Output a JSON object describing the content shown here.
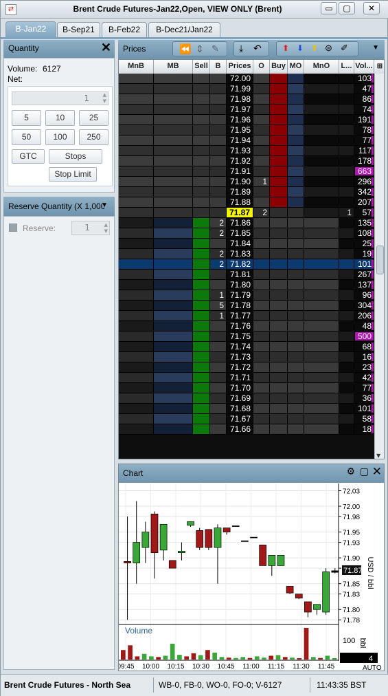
{
  "window": {
    "title": "Brent Crude Futures-Jan22,Open, VIEW ONLY (Brent)",
    "min_glyph": "▭",
    "max_glyph": "▢",
    "close_glyph": "✕"
  },
  "tabs": [
    "B-Jan22",
    "B-Sep21",
    "B-Feb22",
    "B-Dec21/Jan22"
  ],
  "quantity": {
    "title": "Quantity",
    "volume_label": "Volume:",
    "volume_value": "6127",
    "net_label": "Net:",
    "qty_value": "1",
    "presets": [
      "5",
      "10",
      "25",
      "50",
      "100",
      "250"
    ],
    "gtc": "GTC",
    "stops": "Stops",
    "stop_limit": "Stop Limit"
  },
  "reserve": {
    "title": "Reserve Quantity (X 1,000)",
    "label": "Reserve:",
    "value": "1"
  },
  "prices_panel": {
    "title": "Prices",
    "columns": [
      "MnB",
      "MB",
      "Sell",
      "B",
      "Prices",
      "O",
      "Buy",
      "MO",
      "MnO",
      "L...",
      "Vol..."
    ],
    "ltp": "71.87",
    "rows": [
      {
        "price": "72.00",
        "o": "",
        "l": "",
        "vol": "103",
        "mark": "ask"
      },
      {
        "price": "71.99",
        "o": "",
        "l": "",
        "vol": "47",
        "mark": "ask"
      },
      {
        "price": "71.98",
        "o": "",
        "l": "",
        "vol": "86",
        "mark": "ask"
      },
      {
        "price": "71.97",
        "o": "",
        "l": "",
        "vol": "74",
        "mark": "ask"
      },
      {
        "price": "71.96",
        "o": "",
        "l": "",
        "vol": "191",
        "mark": "ask"
      },
      {
        "price": "71.95",
        "o": "",
        "l": "",
        "vol": "78",
        "mark": "ask"
      },
      {
        "price": "71.94",
        "o": "",
        "l": "",
        "vol": "77",
        "mark": "ask"
      },
      {
        "price": "71.93",
        "o": "",
        "l": "",
        "vol": "117",
        "mark": "ask"
      },
      {
        "price": "71.92",
        "o": "",
        "l": "",
        "vol": "178",
        "mark": "ask"
      },
      {
        "price": "71.91",
        "o": "",
        "l": "",
        "vol": "663",
        "mark": "ask"
      },
      {
        "price": "71.90",
        "o": "1",
        "l": "",
        "vol": "296",
        "mark": "ask"
      },
      {
        "price": "71.89",
        "o": "",
        "l": "",
        "vol": "342",
        "mark": "ask"
      },
      {
        "price": "71.88",
        "o": "",
        "l": "",
        "vol": "207",
        "mark": "ask"
      },
      {
        "price": "71.87",
        "o": "2",
        "l": "1",
        "vol": "57",
        "mark": "ltp"
      },
      {
        "price": "71.86",
        "b": "2",
        "vol": "135",
        "mark": "bid"
      },
      {
        "price": "71.85",
        "b": "2",
        "vol": "108",
        "mark": "bid"
      },
      {
        "price": "71.84",
        "b": "",
        "vol": "25",
        "mark": "bid"
      },
      {
        "price": "71.83",
        "b": "2",
        "vol": "19",
        "mark": "bid"
      },
      {
        "price": "71.82",
        "b": "2",
        "vol": "101",
        "mark": "sel"
      },
      {
        "price": "71.81",
        "b": "",
        "vol": "267",
        "mark": "bid"
      },
      {
        "price": "71.80",
        "b": "",
        "vol": "137",
        "mark": "bid"
      },
      {
        "price": "71.79",
        "b": "1",
        "vol": "96",
        "mark": "bid"
      },
      {
        "price": "71.78",
        "b": "5",
        "vol": "304",
        "mark": "bid"
      },
      {
        "price": "71.77",
        "b": "1",
        "vol": "206",
        "mark": "bid"
      },
      {
        "price": "71.76",
        "b": "",
        "vol": "48",
        "mark": "bid"
      },
      {
        "price": "71.75",
        "b": "",
        "vol": "500",
        "mark": "bid"
      },
      {
        "price": "71.74",
        "b": "",
        "vol": "68",
        "mark": "bid"
      },
      {
        "price": "71.73",
        "b": "",
        "vol": "16",
        "mark": "bid"
      },
      {
        "price": "71.72",
        "b": "",
        "vol": "23",
        "mark": "bid"
      },
      {
        "price": "71.71",
        "b": "",
        "vol": "42",
        "mark": "bid"
      },
      {
        "price": "71.70",
        "b": "",
        "vol": "77",
        "mark": "bid"
      },
      {
        "price": "71.69",
        "b": "",
        "vol": "36",
        "mark": "bid"
      },
      {
        "price": "71.68",
        "b": "",
        "vol": "101",
        "mark": "bid"
      },
      {
        "price": "71.67",
        "b": "",
        "vol": "58",
        "mark": "bid"
      },
      {
        "price": "71.66",
        "b": "",
        "vol": "18",
        "mark": "bid"
      }
    ],
    "colors": {
      "ask": "#8b0000",
      "bid": "#0b7a0b",
      "highlight": "#f5f500",
      "volbar": "#b015b0",
      "selected": "#0d3a6e"
    }
  },
  "chart": {
    "title": "Chart",
    "volume_label": "Volume",
    "y_axis_label": "USD / bbl",
    "vol_axis_label": "bbl",
    "vol_tick": "100",
    "vol_current": "4",
    "last_price_tag": "71.87",
    "auto_label": "AUTO",
    "y_ticks": [
      "72.03",
      "72.00",
      "71.98",
      "71.95",
      "71.93",
      "71.90",
      "71.88",
      "71.85",
      "71.83",
      "71.80",
      "71.78"
    ],
    "x_ticks": [
      "09:45",
      "10:00",
      "10:15",
      "10:30",
      "10:45",
      "11:00",
      "11:15",
      "11:30",
      "11:45"
    ]
  },
  "chart_data": {
    "type": "candlestick",
    "ylabel": "USD / bbl",
    "ylim": [
      71.775,
      72.04
    ],
    "candles": [
      {
        "o": 71.89,
        "h": 71.98,
        "l": 71.78,
        "c": 71.893,
        "dir": "down"
      },
      {
        "o": 71.89,
        "h": 72.01,
        "l": 71.85,
        "c": 71.93,
        "dir": "up"
      },
      {
        "o": 71.92,
        "h": 71.97,
        "l": 71.89,
        "c": 71.95,
        "dir": "up"
      },
      {
        "o": 71.985,
        "h": 71.99,
        "l": 71.86,
        "c": 71.91,
        "dir": "down"
      },
      {
        "o": 71.915,
        "h": 71.965,
        "l": 71.895,
        "c": 71.965,
        "dir": "up"
      },
      {
        "o": 71.895,
        "h": 71.895,
        "l": 71.88,
        "c": 71.88,
        "dir": "down"
      },
      {
        "o": 71.91,
        "h": 71.93,
        "l": 71.895,
        "c": 71.913,
        "dir": "up"
      },
      {
        "o": 71.97,
        "h": 71.97,
        "l": 71.96,
        "c": 71.963,
        "dir": "up"
      },
      {
        "o": 71.953,
        "h": 71.958,
        "l": 71.915,
        "c": 71.92,
        "dir": "down"
      },
      {
        "o": 71.955,
        "h": 71.955,
        "l": 71.915,
        "c": 71.92,
        "dir": "down"
      },
      {
        "o": 71.92,
        "h": 71.965,
        "l": 71.85,
        "c": 71.958,
        "dir": "up"
      },
      {
        "o": 71.958,
        "h": 71.958,
        "l": 71.945,
        "c": 71.95,
        "dir": "down"
      },
      {
        "o": 71.962,
        "h": 71.962,
        "l": 71.962,
        "c": 71.962,
        "dir": "flat"
      },
      {
        "o": 71.933,
        "h": 71.933,
        "l": 71.933,
        "c": 71.933,
        "dir": "flat"
      },
      {
        "o": 71.94,
        "h": 71.94,
        "l": 71.94,
        "c": 71.94,
        "dir": "flat"
      },
      {
        "o": 71.925,
        "h": 71.925,
        "l": 71.885,
        "c": 71.885,
        "dir": "down"
      },
      {
        "o": 71.885,
        "h": 71.905,
        "l": 71.865,
        "c": 71.905,
        "dir": "up"
      },
      {
        "o": 71.905,
        "h": 71.905,
        "l": 71.885,
        "c": 71.885,
        "dir": "up"
      },
      {
        "o": 71.845,
        "h": 71.845,
        "l": 71.83,
        "c": 71.832,
        "dir": "down"
      },
      {
        "o": 71.83,
        "h": 71.83,
        "l": 71.82,
        "c": 71.822,
        "dir": "down"
      },
      {
        "o": 71.815,
        "h": 71.815,
        "l": 71.785,
        "c": 71.795,
        "dir": "down"
      },
      {
        "o": 71.8,
        "h": 71.81,
        "l": 71.79,
        "c": 71.81,
        "dir": "up"
      },
      {
        "o": 71.795,
        "h": 71.88,
        "l": 71.79,
        "c": 71.873,
        "dir": "up"
      },
      {
        "o": 71.872,
        "h": 71.88,
        "l": 71.87,
        "c": 71.875,
        "dir": "flat"
      }
    ],
    "volume": [
      {
        "v": 30,
        "dir": "down"
      },
      {
        "v": 45,
        "dir": "down"
      },
      {
        "v": 10,
        "dir": "down"
      },
      {
        "v": 18,
        "dir": "up"
      },
      {
        "v": 10,
        "dir": "up"
      },
      {
        "v": 8,
        "dir": "down"
      },
      {
        "v": 12,
        "dir": "up"
      },
      {
        "v": 50,
        "dir": "up"
      },
      {
        "v": 15,
        "dir": "up"
      },
      {
        "v": 10,
        "dir": "down"
      },
      {
        "v": 20,
        "dir": "down"
      },
      {
        "v": 14,
        "dir": "up"
      },
      {
        "v": 30,
        "dir": "down"
      },
      {
        "v": 22,
        "dir": "up"
      },
      {
        "v": 8,
        "dir": "up"
      },
      {
        "v": 6,
        "dir": "down"
      },
      {
        "v": 5,
        "dir": "up"
      },
      {
        "v": 8,
        "dir": "up"
      },
      {
        "v": 5,
        "dir": "down"
      },
      {
        "v": 10,
        "dir": "up"
      },
      {
        "v": 6,
        "dir": "up"
      },
      {
        "v": 12,
        "dir": "down"
      },
      {
        "v": 14,
        "dir": "up"
      },
      {
        "v": 8,
        "dir": "down"
      },
      {
        "v": 6,
        "dir": "up"
      },
      {
        "v": 4,
        "dir": "down"
      },
      {
        "v": 100,
        "dir": "down"
      },
      {
        "v": 8,
        "dir": "up"
      },
      {
        "v": 5,
        "dir": "down"
      },
      {
        "v": 12,
        "dir": "up"
      },
      {
        "v": 4,
        "dir": "up"
      }
    ]
  },
  "status": {
    "market": "Brent Crude Futures - North Sea",
    "fills": "WB-0, FB-0, WO-0, FO-0; V-6127",
    "time": "11:43:35 BST"
  }
}
